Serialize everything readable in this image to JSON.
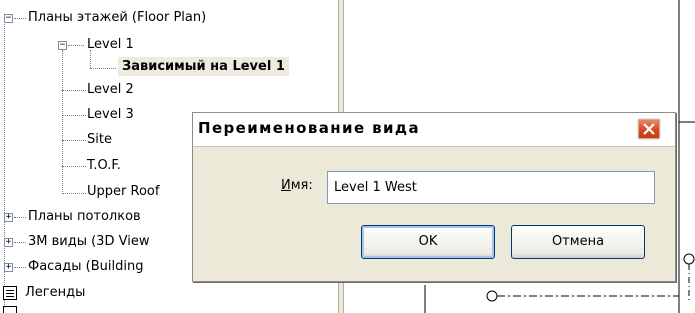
{
  "tree": {
    "floor_plans": "Планы этажей (Floor Plan)",
    "level1": "Level 1",
    "dependent": "Зависимый на Level 1",
    "level2": "Level 2",
    "level3": "Level 3",
    "site": "Site",
    "tof": "T.O.F.",
    "upper_roof": "Upper Roof",
    "ceiling_plans": "Планы потолков",
    "views_3d": "3М виды (3D View",
    "elevations": "Фасады (Building",
    "legends": "Легенды"
  },
  "dialog": {
    "title": "Переименование вида",
    "name_label_underlined": "И",
    "name_label_rest": "мя:",
    "name_value": "Level 1 West",
    "ok_label": "OK",
    "cancel_label": "Отмена"
  },
  "colors": {
    "dialog_bg": "#ece9d8",
    "close_button": "#d2451f",
    "selection_bg": "#eeeae0"
  }
}
